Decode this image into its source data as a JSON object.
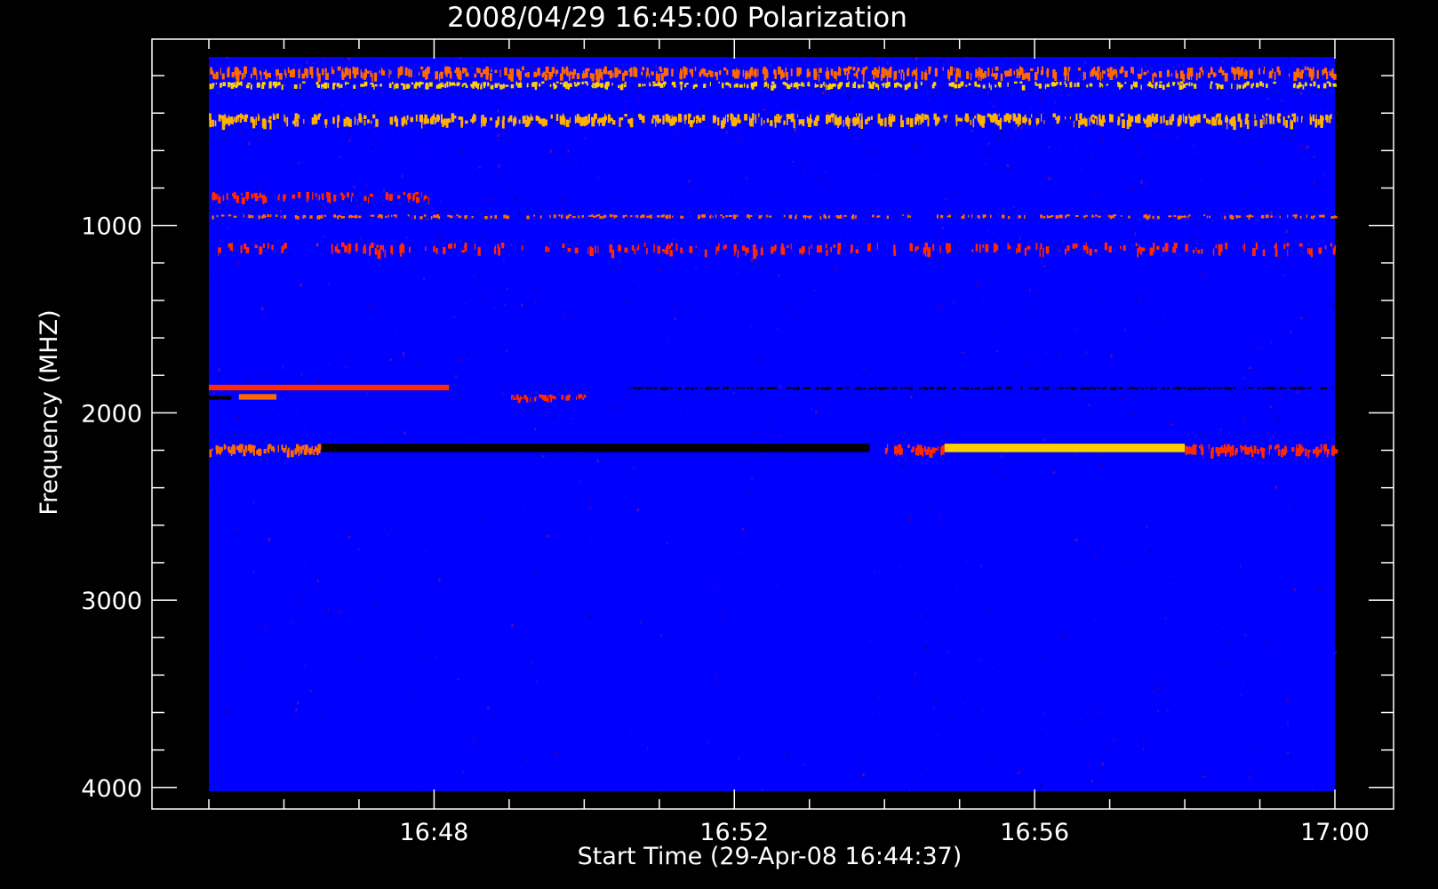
{
  "chart_data": {
    "type": "heatmap",
    "title": "2008/04/29 16:45:00 Polarization",
    "xlabel": "Start Time (29-Apr-08 16:44:37)",
    "ylabel": "Frequency (MHZ)",
    "x_ticks": [
      "16:48",
      "16:52",
      "16:56",
      "17:00"
    ],
    "x_tick_minutes": [
      48,
      52,
      56,
      60
    ],
    "x_minor_minutes": [
      45,
      46,
      47,
      48,
      49,
      50,
      51,
      52,
      53,
      54,
      55,
      56,
      57,
      58,
      59,
      60
    ],
    "y_ticks": [
      "1000",
      "2000",
      "3000",
      "4000"
    ],
    "y_tick_values": [
      1000,
      2000,
      3000,
      4000
    ],
    "xlim_minutes": [
      45,
      60
    ],
    "ylim_mhz": [
      100,
      4020
    ],
    "y_reversed": true,
    "grid": false,
    "colors": {
      "background": "#0000ff",
      "page": "#000000",
      "axis": "#ffffff",
      "hot": "#ff2a00",
      "warm": "#ffd000",
      "cold": "#000000"
    },
    "features": [
      {
        "name": "rfi-band",
        "f0": 150,
        "f1": 200,
        "t0": 45,
        "t1": 60,
        "color": "#ff6a00",
        "density": 0.55
      },
      {
        "name": "rfi-band",
        "f0": 230,
        "f1": 260,
        "t0": 45,
        "t1": 60,
        "color": "#ffd000",
        "density": 0.45
      },
      {
        "name": "rfi-band",
        "f0": 400,
        "f1": 450,
        "t0": 45,
        "t1": 60,
        "color": "#ffb000",
        "density": 0.6
      },
      {
        "name": "rfi-band",
        "f0": 820,
        "f1": 860,
        "t0": 45,
        "t1": 48,
        "color": "#ff2a00",
        "density": 0.4
      },
      {
        "name": "rfi-band",
        "f0": 940,
        "f1": 960,
        "t0": 45,
        "t1": 60,
        "color": "#ff6a00",
        "density": 0.3
      },
      {
        "name": "rfi-band",
        "f0": 1090,
        "f1": 1140,
        "t0": 45,
        "t1": 60,
        "color": "#ff2a00",
        "density": 0.25
      },
      {
        "name": "burst",
        "f0": 1850,
        "f1": 1880,
        "t0": 45,
        "t1": 48.2,
        "color": "#ff2a00",
        "density": 0.9
      },
      {
        "name": "burst",
        "f0": 1900,
        "f1": 1930,
        "t0": 45.4,
        "t1": 45.9,
        "color": "#ff6a00",
        "density": 1.0
      },
      {
        "name": "burst",
        "f0": 1900,
        "f1": 1930,
        "t0": 49,
        "t1": 50,
        "color": "#ff2a00",
        "density": 0.7
      },
      {
        "name": "dark-band",
        "f0": 1910,
        "f1": 1930,
        "t0": 45,
        "t1": 45.3,
        "color": "#000000",
        "density": 1.0
      },
      {
        "name": "dark-band",
        "f0": 1860,
        "f1": 1875,
        "t0": 50.5,
        "t1": 60,
        "color": "#000010",
        "density": 0.5
      },
      {
        "name": "strong-band",
        "f0": 2165,
        "f1": 2210,
        "t0": 45,
        "t1": 46.5,
        "color": "#ff6a00",
        "density": 0.8
      },
      {
        "name": "strong-band",
        "f0": 2165,
        "f1": 2210,
        "t0": 46.5,
        "t1": 53.8,
        "color": "#000000",
        "density": 0.95
      },
      {
        "name": "strong-band",
        "f0": 2165,
        "f1": 2210,
        "t0": 54,
        "t1": 54.8,
        "color": "#ff2a00",
        "density": 0.8
      },
      {
        "name": "strong-band",
        "f0": 2165,
        "f1": 2210,
        "t0": 54.8,
        "t1": 58,
        "color": "#ffd000",
        "density": 0.95
      },
      {
        "name": "strong-band",
        "f0": 2165,
        "f1": 2210,
        "t0": 58,
        "t1": 60,
        "color": "#ff2a00",
        "density": 0.8
      }
    ]
  }
}
